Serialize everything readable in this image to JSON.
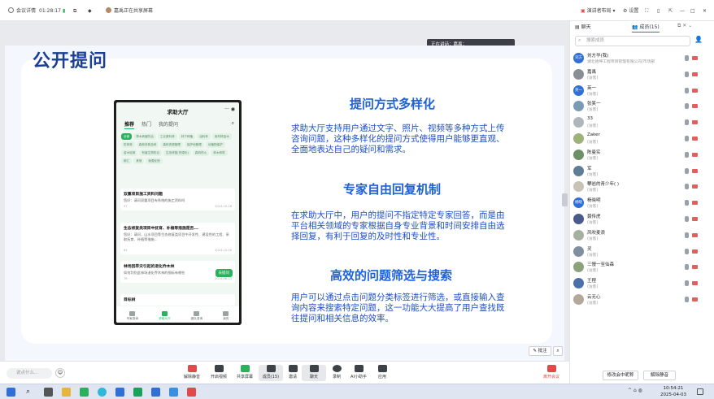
{
  "topbar": {
    "meeting_info": "会议详情",
    "time": "01:28:17",
    "sharing_status": "嘉禹正在共享屏幕",
    "layout_label": "演讲者布局",
    "settings_label": "设置"
  },
  "speaking_overlay": {
    "text": "正在讲话：嘉禹；"
  },
  "slide": {
    "title": "公开提问",
    "phone": {
      "app_title": "求助大厅",
      "tabs": [
        "推荐",
        "热门",
        "我的提问"
      ],
      "chips": [
        "全部",
        "草木病害防治",
        "工业原料林",
        "林下种植",
        "油料林",
        "用材林苗木",
        "防风林",
        "森林抚育品种",
        "森林资源管理",
        "保护地管理",
        "动植物保护",
        "苗木培育",
        "有害生物防治",
        "生态修复(荒漠化)",
        "森林防火",
        "林木种质",
        "碳汇",
        "其他",
        "我要反馈"
      ],
      "posts": [
        {
          "title": "双重项目施工资料问题",
          "body": "您好：请问双重项目有系统的施工资料吗",
          "count": "97",
          "date": "2024-10-26"
        },
        {
          "title": "生态修复类项目中抚育、补植等措施是否...",
          "body": "您好：请问，山水项目等生态修复类项目中开发性、建设性的工程、采取抚育、补植等措施...",
          "count": "64",
          "date": "2024-10-06"
        },
        {
          "title": "林场因旱灾引起的退化乔木林",
          "body": "如何判别此林场退化乔木林的指标有哪些",
          "count": "76",
          "date": "2024-08-13"
        },
        {
          "title": "目标树",
          "body": "",
          "count": "",
          "date": ""
        }
      ],
      "ask_badge": "去提问",
      "nav": [
        "专家咨询",
        "求助大厅",
        "团队咨询",
        "我的"
      ]
    },
    "sections": [
      {
        "heading": "提问方式多样化",
        "text": "求助大厅支持用户通过文字、照片、视频等多种方式上传咨询问题，这种多样化的提问方式使得用户能够更直观、全面地表达自己的疑问和需求。"
      },
      {
        "heading": "专家自由回复机制",
        "text": "在求助大厅中，用户的提问不指定特定专家回答，而是由平台相关领域的专家根据自身专业背景和时间安排自由选择回复，有利于回复的及时性和专业性。"
      },
      {
        "heading": "高效的问题筛选与搜索",
        "text": "用户可以通过点击问题分类标签进行筛选，或直接输入查询内容来搜索特定问题，这一功能大大提高了用户查找既往提问和相关信息的效率。"
      }
    ]
  },
  "annotate_label": "批注",
  "toolbar": {
    "input_placeholder": "说点什么...",
    "buttons": [
      "解除静音",
      "开启视频",
      "共享屏幕",
      "成员(15)",
      "邀请",
      "聊天",
      "录制",
      "AI小助手",
      "应用"
    ],
    "leave": "离开会议"
  },
  "panel": {
    "tabs": [
      "聊天",
      "成员(15)"
    ],
    "search_placeholder": "搜索成员",
    "members": [
      {
        "name": "刘方华(我)",
        "role": "湖北德坤工程项目管理有限公司/市场部",
        "avatar": "刘方华",
        "color": "#2f6fd6"
      },
      {
        "name": "嘉禹",
        "role": "(访客)",
        "avatar": "",
        "color": "#8a8f96"
      },
      {
        "name": "英一",
        "role": "(访客)",
        "avatar": "英一",
        "color": "#2f6fd6"
      },
      {
        "name": "张笑一",
        "role": "(访客)",
        "avatar": "",
        "color": "#7a9bb5"
      },
      {
        "name": "33",
        "role": "(访客)",
        "avatar": "",
        "color": "#b0b6bc"
      },
      {
        "name": "Zaker",
        "role": "(访客)",
        "avatar": "",
        "color": "#9db37a"
      },
      {
        "name": "陈曼实",
        "role": "(访客)",
        "avatar": "",
        "color": "#6f8f6a"
      },
      {
        "name": "军",
        "role": "(访客)",
        "avatar": "",
        "color": "#5f7d96"
      },
      {
        "name": "攀岩的青少年( )",
        "role": "(访客)",
        "avatar": "",
        "color": "#c9c2b6"
      },
      {
        "name": "杨晓明",
        "role": "(访客)",
        "avatar": "杨晓",
        "color": "#2f6fd6"
      },
      {
        "name": "聂传虎",
        "role": "(访客)",
        "avatar": "",
        "color": "#4a5a8a"
      },
      {
        "name": "风吹麦浪",
        "role": "(访客)",
        "avatar": "",
        "color": "#a7b0a0"
      },
      {
        "name": "灵",
        "role": "(访客)",
        "avatar": "",
        "color": "#7f8f9f"
      },
      {
        "name": "三慢一至仙森",
        "role": "(访客)",
        "avatar": "",
        "color": "#8aa27e"
      },
      {
        "name": "王程",
        "role": "(访客)",
        "avatar": "",
        "color": "#4b6fa8"
      },
      {
        "name": "云无心",
        "role": "(访客)",
        "avatar": "",
        "color": "#b2a99a"
      }
    ],
    "mute_all_label": "修改会中昵称",
    "unmute_label": "解除静音"
  },
  "taskbar": {
    "time": "10:54:21",
    "date": "2025-04-03"
  }
}
